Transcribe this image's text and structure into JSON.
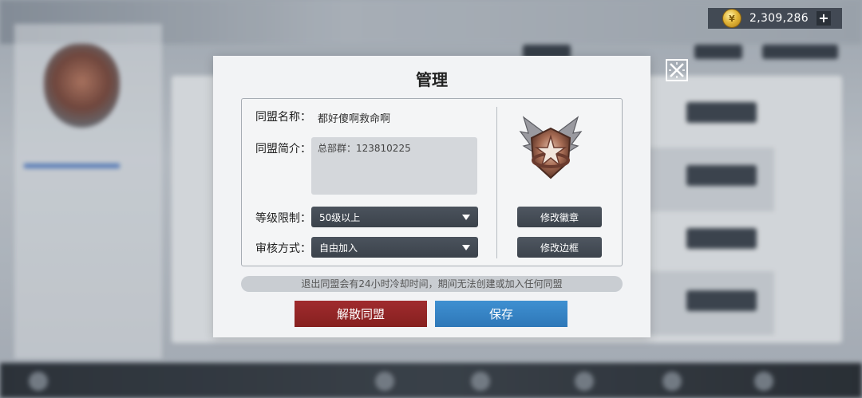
{
  "currency": {
    "icon": "gold-coin-icon",
    "amount": "2,309,286",
    "add_label": "+"
  },
  "modal": {
    "title": "管理",
    "name_label": "同盟名称：",
    "name_value": "都好傻啊救命啊",
    "desc_label": "同盟简介：",
    "desc_value": "总部群：123810225",
    "level_label": "等级限制：",
    "level_value": "50级以上",
    "review_label": "审核方式：",
    "review_value": "自由加入",
    "badge_icon": "alliance-badge-icon",
    "change_badge_label": "修改徽章",
    "change_frame_label": "修改边框",
    "notice": "退出同盟会有24小时冷却时间，期间无法创建或加入任何同盟",
    "disband_label": "解散同盟",
    "save_label": "保存"
  },
  "colors": {
    "disband": "#a02b2e",
    "save": "#3f90d1",
    "dark_button": "#444c56",
    "panel": "#f2f3f5"
  }
}
